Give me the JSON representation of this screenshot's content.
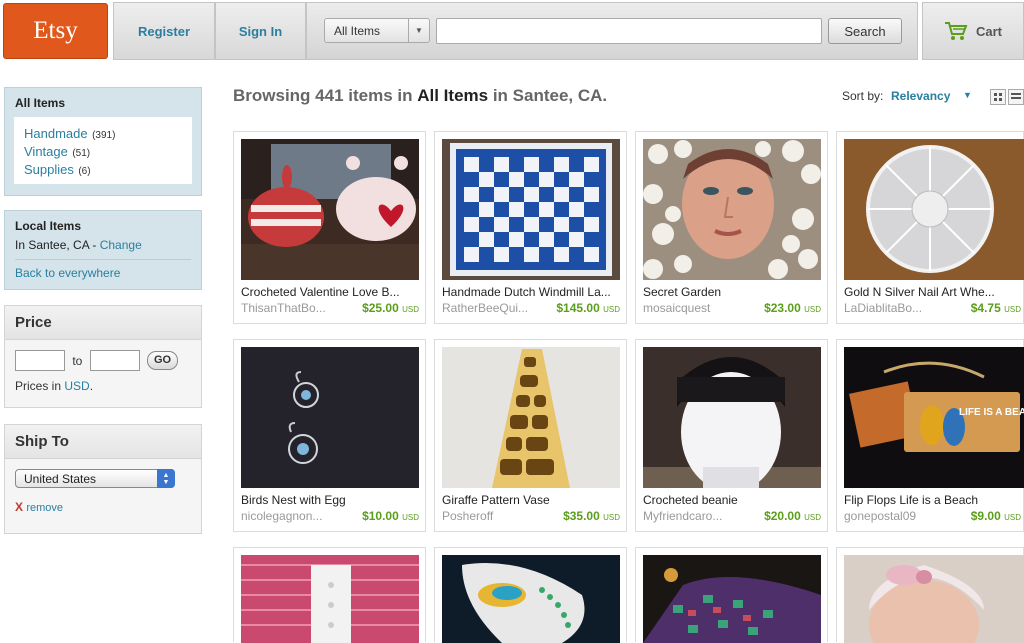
{
  "header": {
    "logo": "Etsy",
    "register": "Register",
    "sign_in": "Sign In",
    "category_select": "All Items",
    "search_placeholder": "",
    "search_button": "Search",
    "cart": "Cart"
  },
  "sidebar": {
    "all_items": {
      "title": "All Items",
      "links": [
        {
          "label": "Handmade",
          "count": "(391)"
        },
        {
          "label": "Vintage",
          "count": "(51)"
        },
        {
          "label": "Supplies",
          "count": "(6)"
        }
      ]
    },
    "local": {
      "title": "Local Items",
      "location": "In Santee, CA - ",
      "change": "Change",
      "back": "Back to everywhere"
    },
    "price": {
      "title": "Price",
      "to": "to",
      "go": "GO",
      "prices_in": "Prices in ",
      "currency": "USD",
      "period": "."
    },
    "ship_to": {
      "title": "Ship To",
      "selected": "United States",
      "remove_x": "X",
      "remove": "remove"
    }
  },
  "browse": {
    "prefix": "Browsing 441 items in ",
    "category": "All Items",
    "suffix": " in Santee, CA."
  },
  "sort": {
    "label": "Sort by:",
    "value": "Relevancy"
  },
  "listings": [
    {
      "title": "Crocheted Valentine Love B...",
      "shop": "ThisanThatBo...",
      "price": "$25.00",
      "currency": "USD"
    },
    {
      "title": "Handmade Dutch Windmill La...",
      "shop": "RatherBeeQui...",
      "price": "$145.00",
      "currency": "USD"
    },
    {
      "title": "Secret Garden",
      "shop": "mosaicquest",
      "price": "$23.00",
      "currency": "USD"
    },
    {
      "title": "Gold N Silver Nail Art Whe...",
      "shop": "LaDiablitaBo...",
      "price": "$4.75",
      "currency": "USD"
    },
    {
      "title": "Birds Nest with Egg",
      "shop": "nicolegagnon...",
      "price": "$10.00",
      "currency": "USD"
    },
    {
      "title": "Giraffe Pattern Vase",
      "shop": "Posheroff",
      "price": "$35.00",
      "currency": "USD"
    },
    {
      "title": "Crocheted beanie",
      "shop": "Myfriendcaro...",
      "price": "$20.00",
      "currency": "USD"
    },
    {
      "title": "Flip Flops Life is a Beach",
      "shop": "gonepostal09",
      "price": "$9.00",
      "currency": "USD"
    },
    {
      "title": "",
      "shop": "",
      "price": "",
      "currency": ""
    },
    {
      "title": "",
      "shop": "",
      "price": "",
      "currency": ""
    },
    {
      "title": "",
      "shop": "",
      "price": "",
      "currency": ""
    },
    {
      "title": "",
      "shop": "",
      "price": "",
      "currency": ""
    }
  ],
  "sign_text": "LIFE IS A BEACH",
  "colors": {
    "brand": "#e0581c",
    "link": "#2a7fa0",
    "price": "#5a9e1a",
    "sidebar_blue": "#d4e4ea"
  }
}
